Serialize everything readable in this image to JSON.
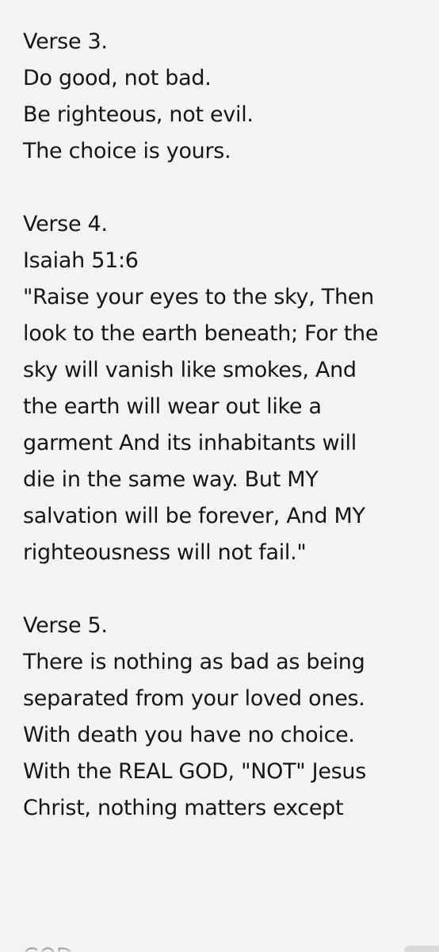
{
  "note": {
    "verse3": {
      "heading": "Verse 3.",
      "lines": [
        "Do good, not bad.",
        "Be righteous, not evil.",
        "The choice is yours."
      ]
    },
    "verse4": {
      "heading": "Verse 4.",
      "lines": [
        "Isaiah 51:6",
        "\"Raise your eyes to the sky, Then",
        "look to the earth beneath; For the",
        "sky will vanish like smokes, And",
        "the earth will wear out like a",
        "garment And its inhabitants will",
        "die in the same way. But MY",
        "salvation will be forever, And MY",
        "righteousness will not fail.\""
      ]
    },
    "verse5": {
      "heading": "Verse 5.",
      "lines": [
        "There is nothing as bad as being",
        "separated from your loved ones.",
        "With death you have no choice.",
        "With the REAL GOD, \"NOT\" Jesus",
        "Christ, nothing matters except"
      ]
    },
    "partial_next_line": "GOD"
  }
}
